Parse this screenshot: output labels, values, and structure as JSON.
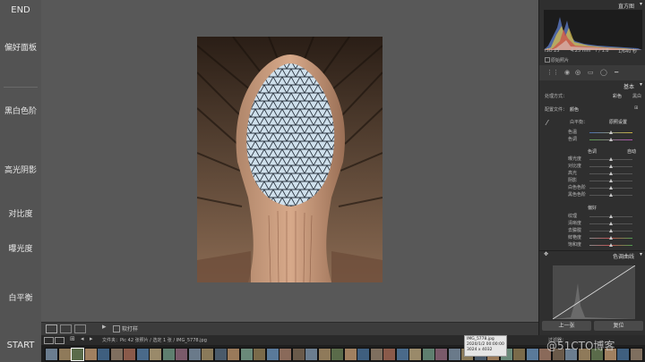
{
  "left_panel": {
    "top_label": "END",
    "items": [
      "偏好面板",
      "黑白色阶",
      "高光阴影",
      "对比度",
      "曝光度",
      "白平衡"
    ],
    "bottom_label": "START"
  },
  "toolbar": {
    "soft_proof": "软打样"
  },
  "right_panel": {
    "histogram_title": "直方图",
    "exif": [
      "ISO 25",
      "4.25 mm",
      "f / 1.8",
      "1/640 秒"
    ],
    "original_photo": "原始照片",
    "basic_title": "基本",
    "treatment_label": "处理方式：",
    "treatment_color": "彩色",
    "treatment_bw": "黑白",
    "profile_label": "配置文件：",
    "profile_value": "颜色",
    "wb_label": "白平衡：",
    "wb_value": "原照设置",
    "wb_sliders": [
      "色温",
      "色调"
    ],
    "tone_label": "色调",
    "tone_auto": "自动",
    "tone_sliders": [
      "曝光度",
      "对比度",
      "高光",
      "阴影",
      "白色色阶",
      "黑色色阶"
    ],
    "presence_label": "偏好",
    "presence_sliders": [
      "纹理",
      "清晰度",
      "去朦胧",
      "鲜艳度",
      "饱和度"
    ],
    "tone_curve_title": "色调曲线",
    "prev_button": "上一张",
    "reset_button": "复位"
  },
  "filmbar": {
    "info": "文件夹：Pic   42 张照片 / 选定 1 张 / IMG_5778.jpg",
    "filter": "过滤器："
  },
  "tooltip": {
    "filename": "IMG_5778.jpg",
    "date": "2020/1/2 00:00:00",
    "dims": "3024 x 4032"
  },
  "watermark": "@51CTO博客",
  "colors": {
    "panel": "#2f2f2f",
    "overlay": "#535353",
    "canvas": "#585858"
  }
}
